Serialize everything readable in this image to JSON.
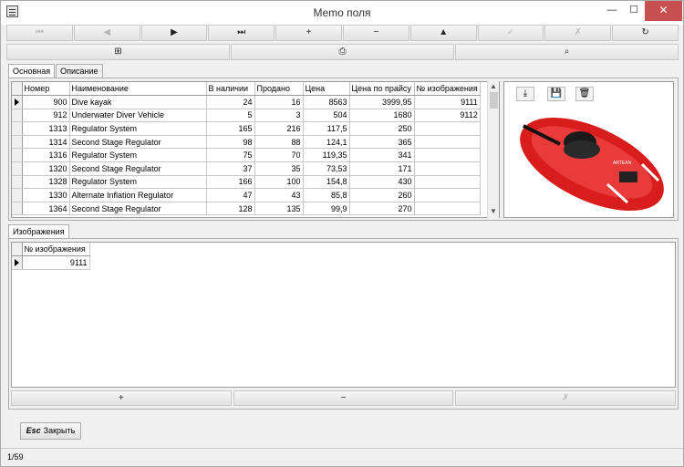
{
  "window": {
    "title": "Memo поля",
    "min_label": "—",
    "max_label": "☐",
    "close_label": "✕"
  },
  "toolbar1": [
    {
      "name": "first-record-button",
      "icon": "first-icon",
      "glyph": "⏮",
      "enabled": false
    },
    {
      "name": "prev-record-button",
      "icon": "prev-icon",
      "glyph": "◀",
      "enabled": false
    },
    {
      "name": "next-record-button",
      "icon": "next-icon",
      "glyph": "▶",
      "enabled": true
    },
    {
      "name": "last-record-button",
      "icon": "last-icon",
      "glyph": "⏭",
      "enabled": true
    },
    {
      "name": "insert-record-button",
      "icon": "plus-icon",
      "glyph": "+",
      "enabled": true
    },
    {
      "name": "delete-record-button",
      "icon": "minus-icon",
      "glyph": "−",
      "enabled": true
    },
    {
      "name": "edit-record-button",
      "icon": "up-arrow-icon",
      "glyph": "▲",
      "enabled": true
    },
    {
      "name": "post-record-button",
      "icon": "check-icon",
      "glyph": "✓",
      "enabled": false
    },
    {
      "name": "cancel-edit-button",
      "icon": "cancel-icon",
      "glyph": "✗",
      "enabled": false
    },
    {
      "name": "refresh-button",
      "icon": "refresh-icon",
      "glyph": "↻",
      "enabled": true
    }
  ],
  "toolbar2": [
    {
      "name": "layout-button",
      "icon": "columns-icon",
      "glyph": "⊞"
    },
    {
      "name": "print-button",
      "icon": "printer-icon",
      "glyph": "⎙"
    },
    {
      "name": "search-button",
      "icon": "binoculars-icon",
      "glyph": "⌕"
    }
  ],
  "tabs_main": [
    {
      "label": "Основная",
      "active": true
    },
    {
      "label": "Описание",
      "active": false
    }
  ],
  "grid": {
    "columns": [
      "Номер",
      "Наименование",
      "В наличии",
      "Продано",
      "Цена",
      "Цена по прайсу",
      "№ изображения"
    ],
    "rows": [
      [
        "900",
        "Dive kayak",
        "24",
        "16",
        "8563",
        "3999,95",
        "9111"
      ],
      [
        "912",
        "Underwater Diver Vehicle",
        "5",
        "3",
        "504",
        "1680",
        "9112"
      ],
      [
        "1313",
        "Regulator System",
        "165",
        "216",
        "117,5",
        "250",
        ""
      ],
      [
        "1314",
        "Second Stage Regulator",
        "98",
        "88",
        "124,1",
        "365",
        ""
      ],
      [
        "1316",
        "Regulator System",
        "75",
        "70",
        "119,35",
        "341",
        ""
      ],
      [
        "1320",
        "Second Stage Regulator",
        "37",
        "35",
        "73,53",
        "171",
        ""
      ],
      [
        "1328",
        "Regulator System",
        "166",
        "100",
        "154,8",
        "430",
        ""
      ],
      [
        "1330",
        "Alternate Inflation Regulator",
        "47",
        "43",
        "85,8",
        "260",
        ""
      ],
      [
        "1364",
        "Second Stage Regulator",
        "128",
        "135",
        "99,9",
        "270",
        ""
      ]
    ],
    "selected_row": 0
  },
  "image_panel": {
    "buttons": [
      {
        "name": "load-image-button",
        "icon": "download-icon",
        "glyph": "⤓"
      },
      {
        "name": "save-image-button",
        "icon": "floppy-icon",
        "glyph": "💾"
      },
      {
        "name": "clear-image-button",
        "icon": "trash-icon",
        "glyph": "🗑"
      }
    ],
    "image_text": "ARTEAN"
  },
  "tabs_detail": [
    {
      "label": "Изображения",
      "active": true
    }
  ],
  "detail_grid": {
    "column": "№ изображения",
    "rows": [
      "9111"
    ]
  },
  "toolbar3": [
    {
      "name": "add-image-button",
      "icon": "plus-icon",
      "glyph": "+",
      "enabled": true
    },
    {
      "name": "remove-image-button",
      "icon": "minus-icon",
      "glyph": "−",
      "enabled": true
    },
    {
      "name": "cancel-image-button",
      "icon": "cancel-icon",
      "glyph": "✗",
      "enabled": false
    }
  ],
  "close_button": {
    "esc": "Esc",
    "label": "Закрыть"
  },
  "status": {
    "record_position": "1/59"
  }
}
